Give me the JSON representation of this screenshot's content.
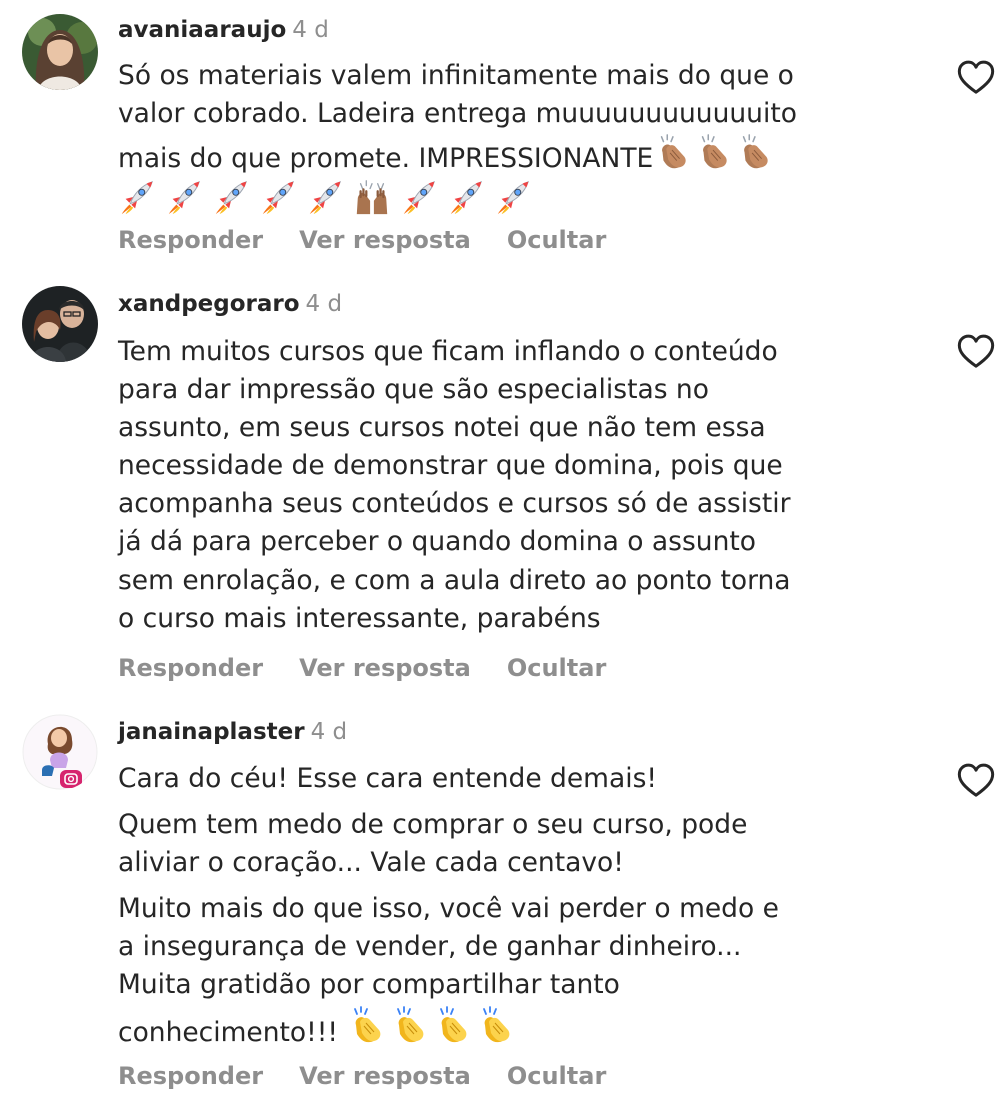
{
  "comments": [
    {
      "username": "avaniaaraujo",
      "time": "4 d",
      "lines": [
        "Só os materiais valem infinitamente mais do que o",
        "valor cobrado. Ladeira entrega muuuuuuuuuuuuito",
        "mais do que promete. IMPRESSIONANTE"
      ],
      "emoji_after_last_line": [
        "clapping-hands-medium",
        "clapping-hands-medium",
        "clapping-hands-medium"
      ],
      "emoji_line": [
        "rocket",
        "rocket",
        "rocket",
        "rocket",
        "rocket",
        "raising-hands-medium",
        "rocket",
        "rocket",
        "rocket"
      ],
      "actions": {
        "reply": "Responder",
        "view_replies": "Ver resposta",
        "hide": "Ocultar"
      },
      "like_icon": "heart-outline-icon"
    },
    {
      "username": "xandpegoraro",
      "time": "4 d",
      "lines": [
        "Tem muitos cursos que ficam inflando o conteúdo",
        "para dar impressão que são especialistas no",
        "assunto, em seus cursos notei que não tem essa",
        "necessidade de demonstrar que domina, pois que",
        "acompanha seus conteúdos e cursos só de assistir",
        "já dá para perceber o quando domina o assunto",
        "sem enrolação, e com a aula direto ao ponto torna",
        "o curso mais interessante, parabéns"
      ],
      "actions": {
        "reply": "Responder",
        "view_replies": "Ver resposta",
        "hide": "Ocultar"
      },
      "like_icon": "heart-outline-icon"
    },
    {
      "username": "janainaplaster",
      "time": "4 d",
      "paragraphs": [
        [
          "Cara do céu! Esse cara entende demais!"
        ],
        [
          "Quem tem medo de comprar o seu curso, pode",
          "aliviar o coração... Vale cada centavo!"
        ],
        [
          "Muito mais do que  isso, você vai perder o medo e",
          "a insegurança de vender, de ganhar dinheiro...",
          "Muita gratidão por compartilhar tanto",
          "conhecimento!!!"
        ]
      ],
      "emoji_after_last_line": [
        "clapping-hands-yellow",
        "clapping-hands-yellow",
        "clapping-hands-yellow",
        "clapping-hands-yellow"
      ],
      "actions": {
        "reply": "Responder",
        "view_replies": "Ver resposta",
        "hide": "Ocultar"
      },
      "like_icon": "heart-outline-icon"
    }
  ],
  "colors": {
    "text": "#262626",
    "secondary": "#8e8e8e",
    "background": "#ffffff"
  }
}
